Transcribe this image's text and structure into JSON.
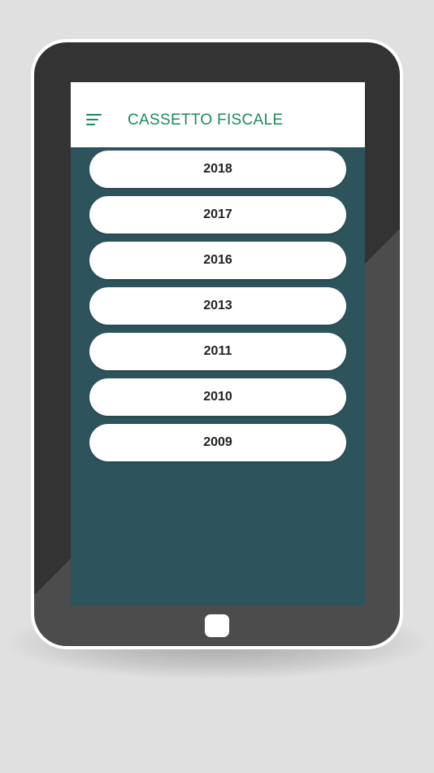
{
  "app": {
    "title": "CASSETTO FISCALE",
    "menu_icon": "hamburger-menu-icon"
  },
  "years": [
    "2018",
    "2017",
    "2016",
    "2013",
    "2011",
    "2010",
    "2009"
  ],
  "colors": {
    "background": "#e0e0e0",
    "tablet_frame": "#333333",
    "screen_background": "#2d535c",
    "accent": "#1e8a5a",
    "button_background": "#ffffff"
  }
}
